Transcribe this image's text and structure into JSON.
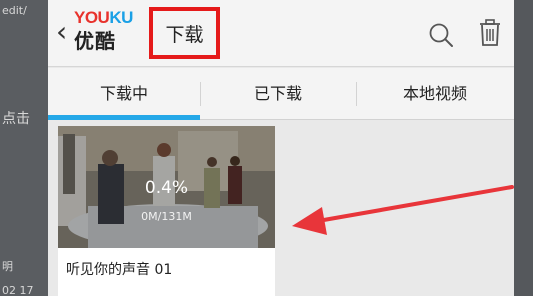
{
  "background": {
    "left_texts": [
      "edit/",
      "点击",
      "明",
      "02 17"
    ]
  },
  "header": {
    "back_glyph": "‹",
    "logo_you": "YOU",
    "logo_ku": "KU",
    "logo_cn": "优酷",
    "title": "下载",
    "search_icon": "search-icon",
    "trash_icon": "trash-icon"
  },
  "tabs": [
    {
      "label": "下载中",
      "active": true
    },
    {
      "label": "已下载",
      "active": false
    },
    {
      "label": "本地视频",
      "active": false
    }
  ],
  "download_item": {
    "progress_text": "0.4%",
    "size_text": "0M/131M",
    "title": "听见你的声音 01"
  },
  "colors": {
    "highlight_box": "#e51a1a",
    "tab_indicator": "#25a8e8",
    "arrow": "#e8353a",
    "logo_red": "#e8322c",
    "logo_blue": "#1aa0e6"
  }
}
